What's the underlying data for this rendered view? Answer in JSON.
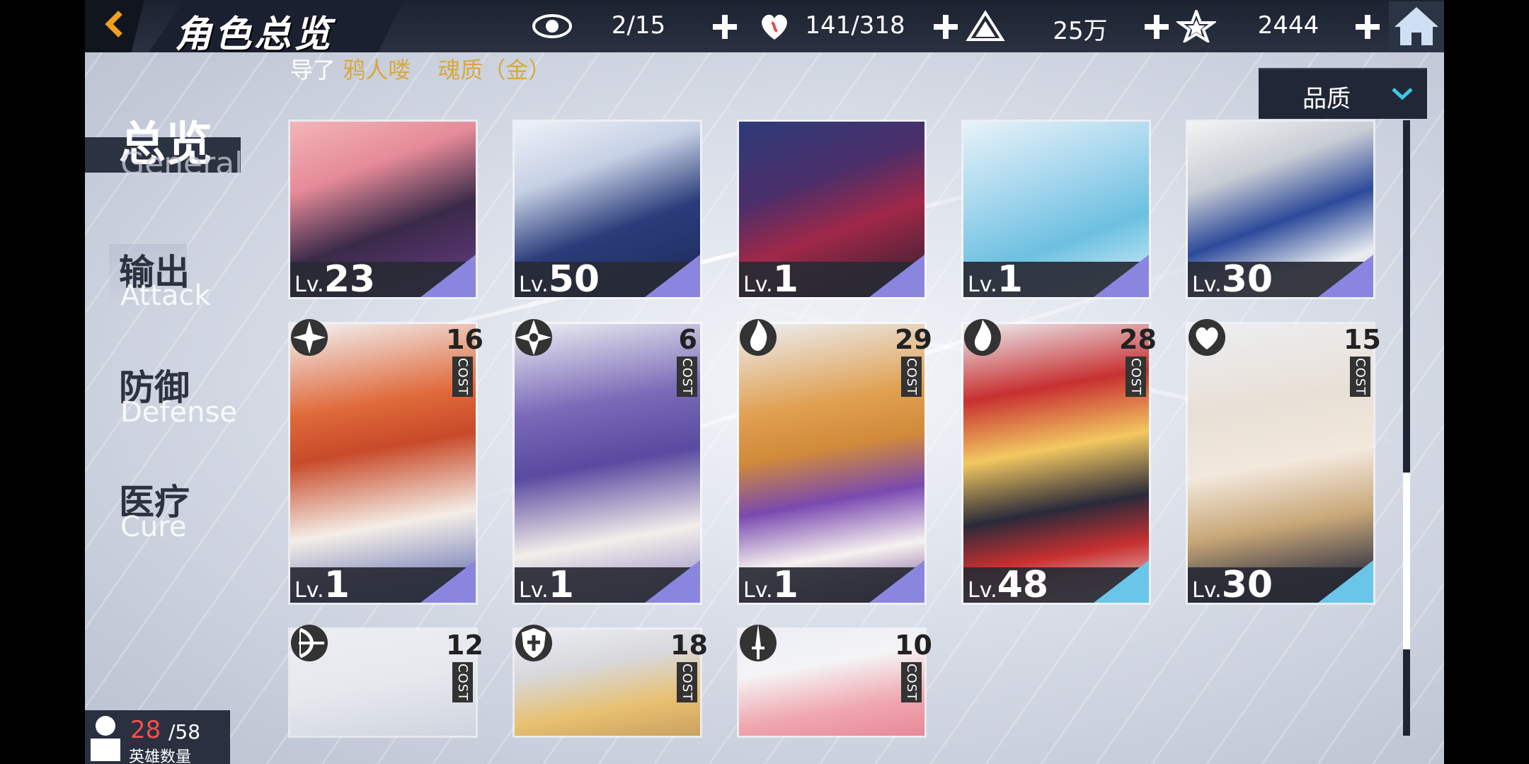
{
  "header": {
    "title": "角色总览",
    "resources": [
      {
        "name": "eye",
        "value": "2/15"
      },
      {
        "name": "stamina",
        "value": "141/318"
      },
      {
        "name": "gold",
        "value": "25万"
      },
      {
        "name": "crystal",
        "value": "2444"
      }
    ]
  },
  "ticker": {
    "prefix": "导了",
    "highlight1": "鸦人喽",
    "highlight2": "魂质（金）"
  },
  "sort": {
    "label": "品质"
  },
  "nav": [
    {
      "zh": "总览",
      "en": "General"
    },
    {
      "zh": "输出",
      "en": "Attack"
    },
    {
      "zh": "防御",
      "en": "Defense"
    },
    {
      "zh": "医疗",
      "en": "Cure"
    }
  ],
  "cards_row1": [
    {
      "lv_prefix": "Lv.",
      "lv": "23"
    },
    {
      "lv_prefix": "Lv.",
      "lv": "50"
    },
    {
      "lv_prefix": "Lv.",
      "lv": "1"
    },
    {
      "lv_prefix": "Lv.",
      "lv": "1"
    },
    {
      "lv_prefix": "Lv.",
      "lv": "30"
    }
  ],
  "cards_row2": [
    {
      "lv_prefix": "Lv.",
      "lv": "1",
      "cost": "16",
      "cost_label": "COST"
    },
    {
      "lv_prefix": "Lv.",
      "lv": "1",
      "cost": "6",
      "cost_label": "COST"
    },
    {
      "lv_prefix": "Lv.",
      "lv": "1",
      "cost": "29",
      "cost_label": "COST"
    },
    {
      "lv_prefix": "Lv.",
      "lv": "48",
      "cost": "28",
      "cost_label": "COST"
    },
    {
      "lv_prefix": "Lv.",
      "lv": "30",
      "cost": "15",
      "cost_label": "COST"
    }
  ],
  "cards_row3": [
    {
      "cost": "12",
      "cost_label": "COST"
    },
    {
      "cost": "18",
      "cost_label": "COST"
    },
    {
      "cost": "10",
      "cost_label": "COST"
    }
  ],
  "hero_count": {
    "current": "28",
    "max": "/58",
    "label": "英雄数量"
  },
  "colors": {
    "accent_orange": "#f0a020",
    "gold_text": "#d8a840",
    "rarity_purple": "#8a86e0",
    "rarity_cyan": "#6ac6e8",
    "count_red": "#ff4d4d"
  }
}
